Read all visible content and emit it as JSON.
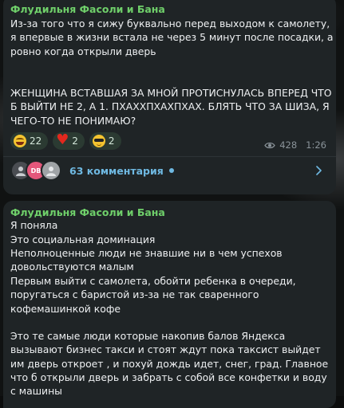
{
  "post1": {
    "author": "Флудильня Фасоли и Бана",
    "text_paragraph1": "Из-за того что я сижу буквально перед выходом к самолету, я впервые в жизни встала не через 5 минут после посадки, а ровно когда открыли дверь",
    "text_paragraph2": "ЖЕНЩИНА ВСТАВШАЯ ЗА МНОЙ ПРОТИСНУЛАСЬ ВПЕРЕД ЧТО Б ВЫЙТИ НЕ 2, А 1. ПХАХХПХАХПХАХ. БЛЯТЬ ЧТО ЗА ШИЗА, Я ЧЕГО-ТО НЕ ПОНИМАЮ?",
    "reactions": [
      {
        "emoji": "grinning-squinting-face",
        "count": "22"
      },
      {
        "emoji": "red-heart",
        "count": "2"
      },
      {
        "emoji": "smiling-face-with-sunglasses",
        "count": "2"
      }
    ],
    "views": "428",
    "time": "1:26",
    "comments_label": "63 комментария",
    "avatar2_initials": "DB"
  },
  "post2": {
    "author": "Флудильня Фасоли и Бана",
    "lines": [
      "Я поняла",
      "Это социальная доминация",
      "Неполноценные люди не знавшие ни в чем успехов довольствуются малым",
      "Первым выйти с самолета, обойти ребенка в очереди, поругаться с баристой из-за не так сваренного кофемашинкой кофе",
      "",
      "Это те самые люди которые накопив балов Яндекса вызывают бизнес такси и стоят ждут пока таксист выйдет им дверь откроет , и похуй дождь идет, снег, град. Главное что б открыли дверь и забрать с собой все конфетки и воду с машины"
    ]
  },
  "colors": {
    "author": "#6fcf6a",
    "link": "#6fb9e2",
    "bubble": "#1f2426",
    "reaction_bg": "#2b3a32"
  }
}
